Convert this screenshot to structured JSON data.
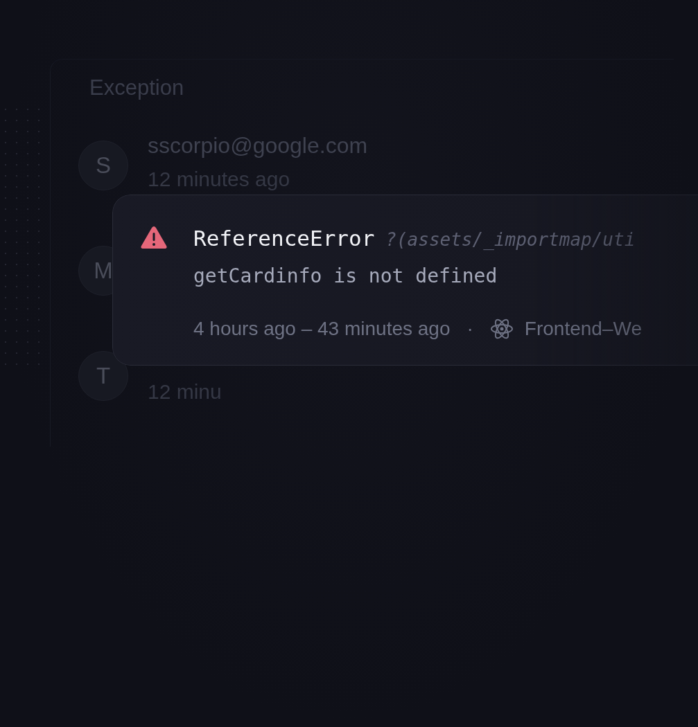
{
  "panel": {
    "title": "Exception",
    "rows": [
      {
        "initial": "S",
        "email": "sscorpio@google.com",
        "time": "12 minutes ago"
      },
      {
        "initial": "M"
      },
      {
        "initial": "T",
        "time": "12 minu"
      }
    ]
  },
  "error_card": {
    "type": "ReferenceError",
    "location": "?(assets/_importmap/uti",
    "message": "getCardinfo is not defined",
    "time_range": "4 hours ago – 43 minutes ago",
    "separator": "·",
    "project": "Frontend–We"
  }
}
